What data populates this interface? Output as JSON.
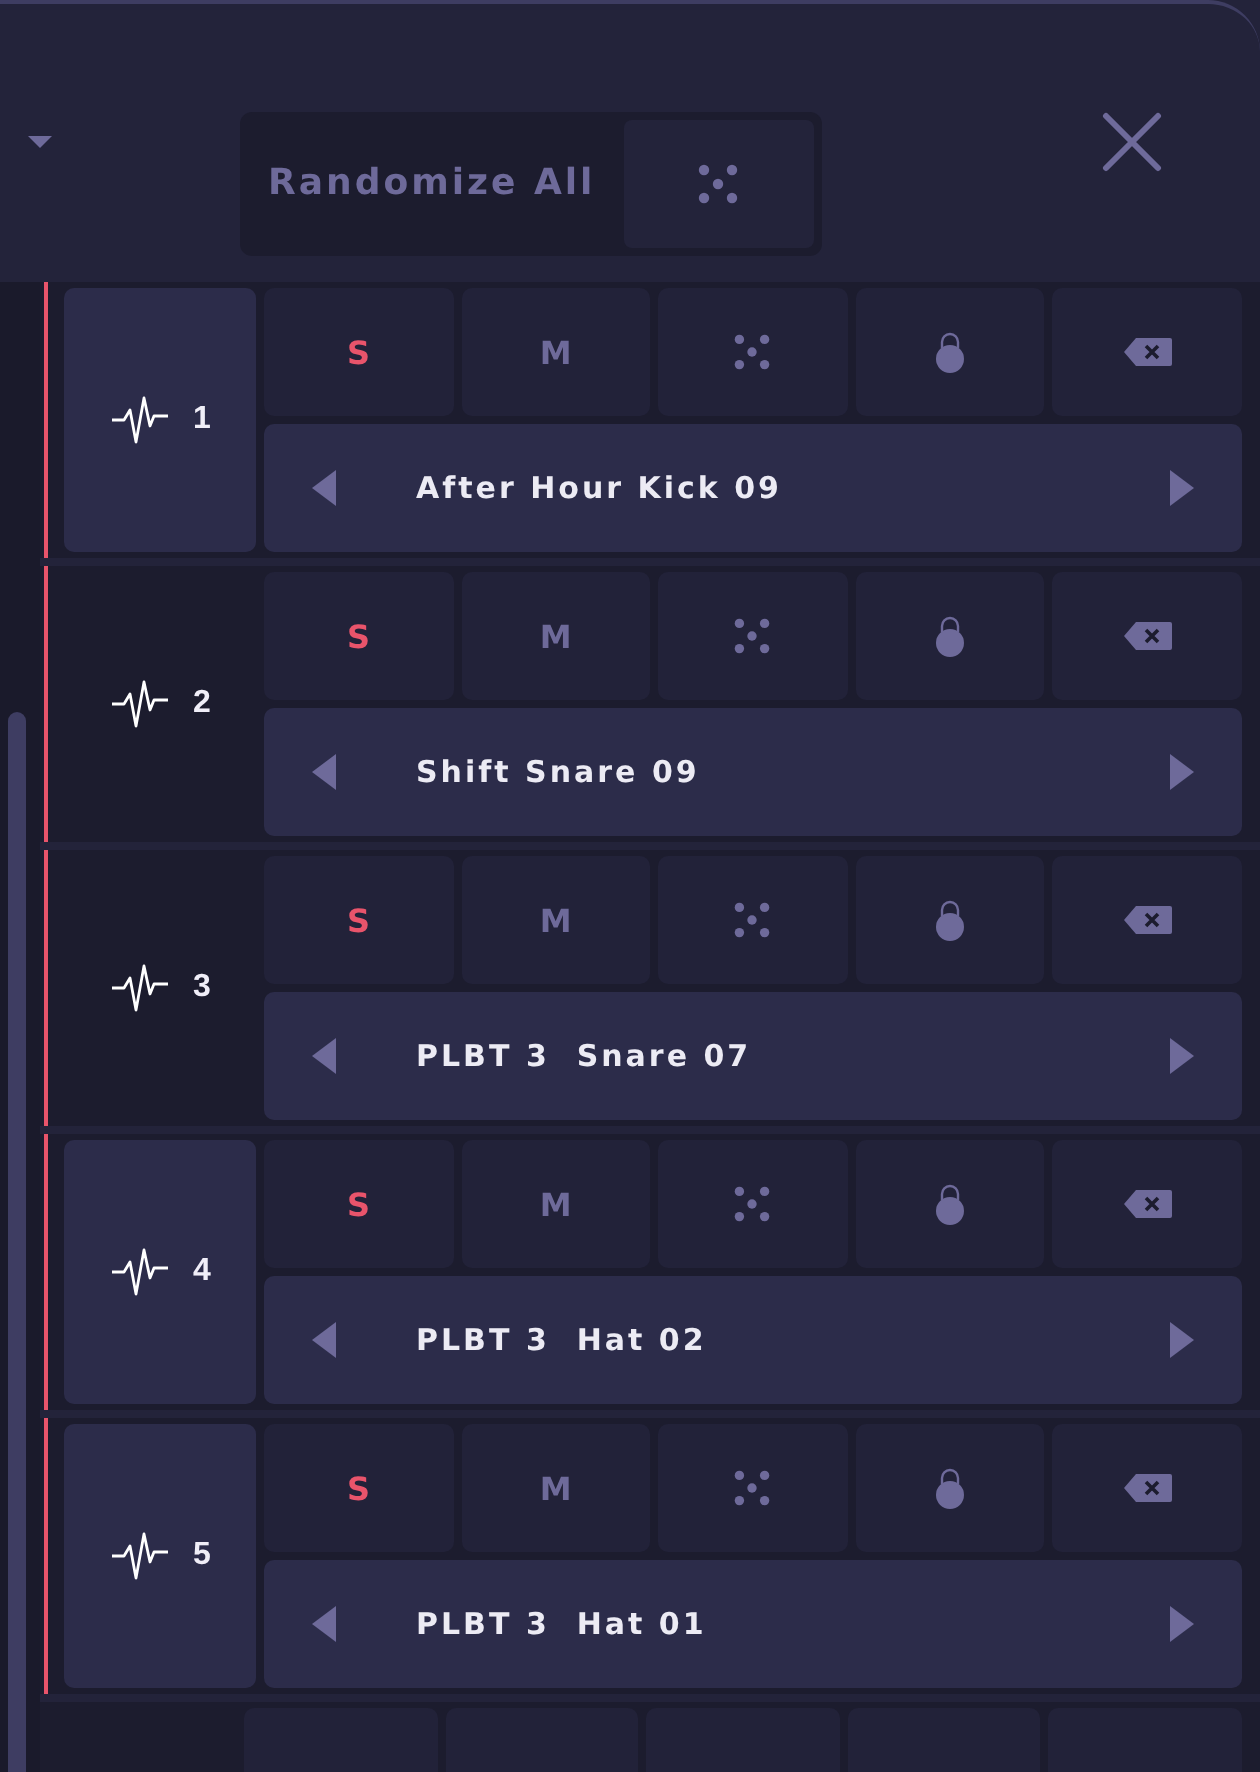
{
  "header": {
    "randomize_label": "Randomize All"
  },
  "tracks": [
    {
      "number": "1",
      "sample": "After Hour Kick 09",
      "selected": true,
      "solo": "S",
      "mute": "M"
    },
    {
      "number": "2",
      "sample": "Shift Snare 09",
      "selected": false,
      "solo": "S",
      "mute": "M"
    },
    {
      "number": "3",
      "sample": "PLBT 3  Snare 07",
      "selected": false,
      "solo": "S",
      "mute": "M"
    },
    {
      "number": "4",
      "sample": "PLBT 3  Hat 02",
      "selected": true,
      "solo": "S",
      "mute": "M"
    },
    {
      "number": "5",
      "sample": "PLBT 3  Hat 01",
      "selected": true,
      "solo": "S",
      "mute": "M"
    }
  ]
}
